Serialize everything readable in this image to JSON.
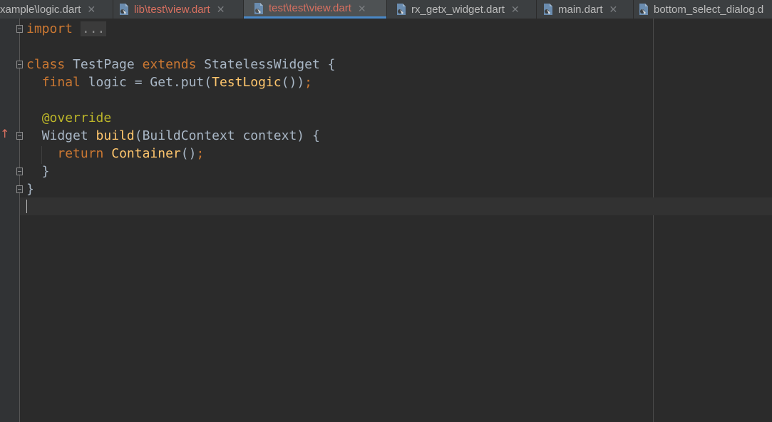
{
  "tabs": [
    {
      "label": "xample\\logic.dart",
      "modified": false,
      "active": false,
      "close": "✕"
    },
    {
      "label": "lib\\test\\view.dart",
      "modified": true,
      "active": false,
      "close": "✕"
    },
    {
      "label": "test\\test\\view.dart",
      "modified": true,
      "active": true,
      "close": "✕"
    },
    {
      "label": "rx_getx_widget.dart",
      "modified": false,
      "active": false,
      "close": "✕"
    },
    {
      "label": "main.dart",
      "modified": false,
      "active": false,
      "close": "✕"
    },
    {
      "label": "bottom_select_dialog.d",
      "modified": false,
      "active": false,
      "close": ""
    }
  ],
  "editor": {
    "lines": [
      {
        "tokens": [
          {
            "t": "import",
            "c": "kw"
          },
          {
            "t": " ",
            "c": ""
          },
          {
            "t": "...",
            "c": "fold-text"
          }
        ]
      },
      {
        "tokens": []
      },
      {
        "tokens": [
          {
            "t": "class",
            "c": "kw"
          },
          {
            "t": " TestPage ",
            "c": "cls"
          },
          {
            "t": "extends",
            "c": "kw"
          },
          {
            "t": " StatelessWidget {",
            "c": "cls"
          }
        ]
      },
      {
        "tokens": [
          {
            "t": "  ",
            "c": ""
          },
          {
            "t": "final",
            "c": "kw"
          },
          {
            "t": " logic = Get.put(",
            "c": "cls"
          },
          {
            "t": "TestLogic",
            "c": "fn"
          },
          {
            "t": "())",
            "c": "cls"
          },
          {
            "t": ";",
            "c": "kw"
          }
        ]
      },
      {
        "tokens": []
      },
      {
        "tokens": [
          {
            "t": "  ",
            "c": ""
          },
          {
            "t": "@override",
            "c": "ann"
          }
        ]
      },
      {
        "tokens": [
          {
            "t": "  Widget ",
            "c": "cls"
          },
          {
            "t": "build",
            "c": "fn"
          },
          {
            "t": "(BuildContext context) {",
            "c": "cls"
          }
        ]
      },
      {
        "tokens": [
          {
            "t": "    ",
            "c": ""
          },
          {
            "t": "return",
            "c": "kw"
          },
          {
            "t": " ",
            "c": ""
          },
          {
            "t": "Container",
            "c": "fn"
          },
          {
            "t": "()",
            "c": "cls"
          },
          {
            "t": ";",
            "c": "kw"
          }
        ]
      },
      {
        "tokens": [
          {
            "t": "  }",
            "c": "cls"
          }
        ]
      },
      {
        "tokens": [
          {
            "t": "}",
            "c": "cls"
          }
        ]
      },
      {
        "tokens": []
      }
    ],
    "override_marker": "↑"
  },
  "colors": {
    "background": "#2b2b2b",
    "keyword": "#cc7832",
    "function": "#ffc66d",
    "annotation": "#bbb529",
    "modified_tab": "#d87060"
  }
}
